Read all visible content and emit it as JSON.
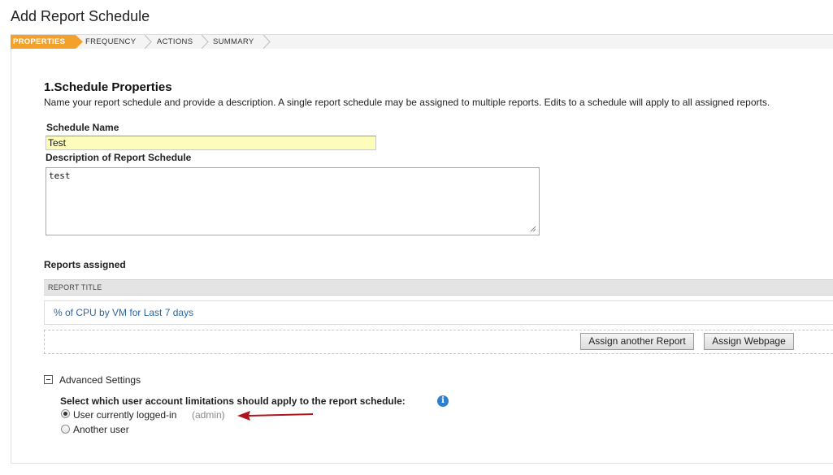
{
  "window": {
    "title": "Add Report Schedule"
  },
  "wizard": {
    "steps": [
      {
        "label": "PROPERTIES",
        "active": true
      },
      {
        "label": "FREQUENCY",
        "active": false
      },
      {
        "label": "ACTIONS",
        "active": false
      },
      {
        "label": "SUMMARY",
        "active": false
      }
    ]
  },
  "section": {
    "title": "1.Schedule Properties",
    "description": "Name your report schedule and provide a description. A single report schedule may be assigned to multiple reports. Edits to a schedule will apply to all assigned reports."
  },
  "schedule_name": {
    "label": "Schedule Name",
    "value": "Test"
  },
  "description_field": {
    "label": "Description of Report Schedule",
    "value": "test"
  },
  "reports": {
    "label": "Reports assigned",
    "column_header": "REPORT TITLE",
    "rows": [
      "% of CPU by VM for Last 7 days"
    ],
    "assign_report_label": "Assign another Report",
    "assign_webpage_label": "Assign Webpage"
  },
  "advanced": {
    "label": "Advanced Settings",
    "prompt": "Select which user account limitations should apply to the report schedule:",
    "options": [
      {
        "label": "User currently logged-in",
        "note": "(admin)",
        "checked": true
      },
      {
        "label": "Another user",
        "checked": false
      }
    ]
  },
  "colors": {
    "active_step": "#f4a12b",
    "link": "#2e67a5",
    "input_highlight": "#fdfdb9",
    "annotation_arrow": "#b0141c"
  }
}
